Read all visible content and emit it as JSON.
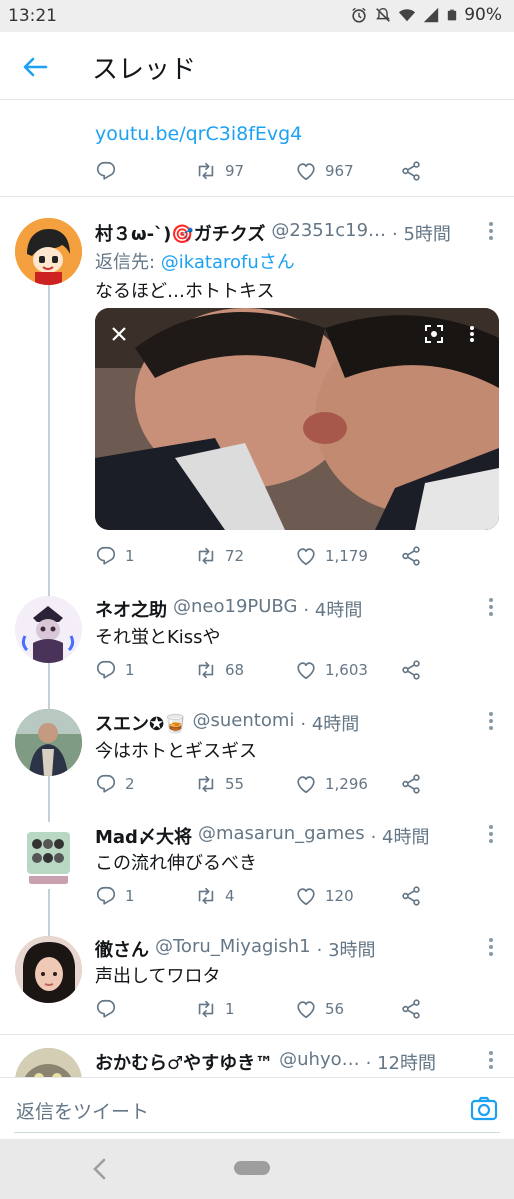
{
  "status_bar": {
    "time": "13:21",
    "battery": "90%"
  },
  "header": {
    "title": "スレッド"
  },
  "top_tweet": {
    "link": "youtu.be/qrC3i8fEvg4",
    "reply_count": "",
    "retweet_count": "97",
    "like_count": "967"
  },
  "tweets": [
    {
      "name": "村３ω-`)🎯ガチクズ",
      "handle": "@2351c19…",
      "time": "· 5時間",
      "reply_to_label": "返信先: ",
      "reply_to": "@ikatarofuさん",
      "text": "なるほど…ホトトキス",
      "has_photo": true,
      "replies": "1",
      "retweets": "72",
      "likes": "1,179"
    },
    {
      "name": "ネオ之助",
      "handle": "@neo19PUBG",
      "time": "· 4時間",
      "text": "それ蛍とKissや",
      "replies": "1",
      "retweets": "68",
      "likes": "1,603"
    },
    {
      "name": "スエン✪🥃",
      "handle": "@suentomi",
      "time": "· 4時間",
      "text": "今はホトとギスギス",
      "replies": "2",
      "retweets": "55",
      "likes": "1,296"
    },
    {
      "name": "Mad〆大将",
      "handle": "@masarun_games",
      "time": "· 4時間",
      "text": "この流れ伸びるべき",
      "replies": "1",
      "retweets": "4",
      "likes": "120"
    },
    {
      "name": "徹さん",
      "handle": "@Toru_Miyagish1",
      "time": "· 3時間",
      "text": "声出してワロタ",
      "replies": "",
      "retweets": "1",
      "likes": "56"
    },
    {
      "name": "おかむら♂やすゆき™",
      "handle": "@uhyo…",
      "time": "· 12時間"
    }
  ],
  "composer": {
    "placeholder": "返信をツイート"
  },
  "colors": {
    "accent": "#1da1f2",
    "muted": "#657786",
    "divider": "#e1e8ed"
  },
  "icons": [
    "back-arrow-icon",
    "reply-icon",
    "retweet-icon",
    "like-icon",
    "share-icon",
    "more-icon",
    "camera-icon",
    "close-icon",
    "scan-icon"
  ]
}
